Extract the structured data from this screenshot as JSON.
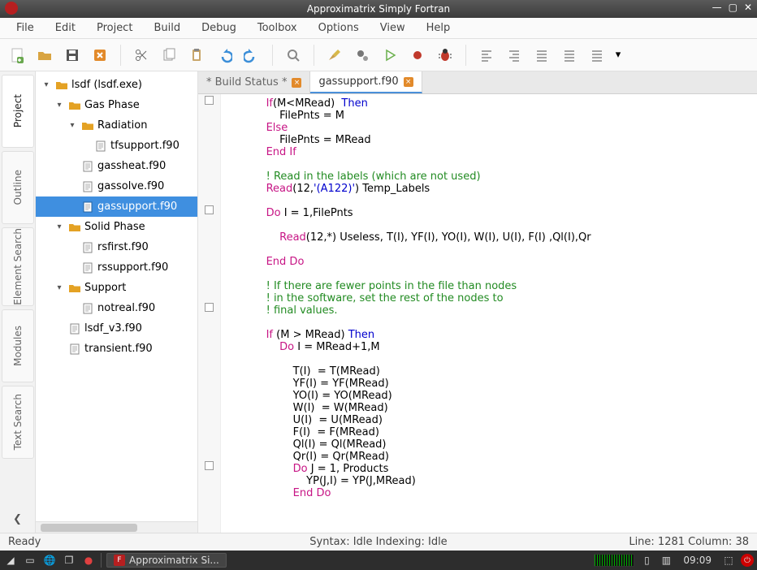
{
  "title": "Approximatrix Simply Fortran",
  "menus": [
    "File",
    "Edit",
    "Project",
    "Build",
    "Debug",
    "Toolbox",
    "Options",
    "View",
    "Help"
  ],
  "toolbar_buttons": [
    {
      "name": "new",
      "icon": "file-plus",
      "color": "#6aa84f"
    },
    {
      "name": "open",
      "icon": "folder-open",
      "color": "#d9a441"
    },
    {
      "name": "save",
      "icon": "floppy",
      "color": "#555"
    },
    {
      "name": "close",
      "icon": "close",
      "color": "#e28a2b"
    },
    {
      "name": "sep"
    },
    {
      "name": "cut",
      "icon": "scissors",
      "color": "#666"
    },
    {
      "name": "copy",
      "icon": "copy",
      "color": "#999"
    },
    {
      "name": "paste",
      "icon": "clipboard",
      "color": "#c9a76b"
    },
    {
      "name": "undo",
      "icon": "undo",
      "color": "#3b8ed8"
    },
    {
      "name": "redo",
      "icon": "redo",
      "color": "#3b8ed8"
    },
    {
      "name": "sep"
    },
    {
      "name": "find",
      "icon": "zoom",
      "color": "#888"
    },
    {
      "name": "sep"
    },
    {
      "name": "clean",
      "icon": "broom",
      "color": "#d8b94a"
    },
    {
      "name": "build",
      "icon": "gears",
      "color": "#777"
    },
    {
      "name": "run",
      "icon": "play",
      "color": "#6ab04c"
    },
    {
      "name": "record",
      "icon": "record",
      "color": "#c0392b"
    },
    {
      "name": "debug",
      "icon": "bug",
      "color": "#c0392b"
    },
    {
      "name": "sep"
    },
    {
      "name": "indent-left",
      "icon": "indentL",
      "color": "#888"
    },
    {
      "name": "indent-right",
      "icon": "indentR",
      "color": "#888"
    },
    {
      "name": "align1",
      "icon": "align",
      "color": "#888"
    },
    {
      "name": "align2",
      "icon": "align",
      "color": "#888"
    },
    {
      "name": "align3",
      "icon": "align",
      "color": "#888"
    }
  ],
  "sidepanels": [
    {
      "id": "project",
      "label": "Project",
      "active": true
    },
    {
      "id": "outline",
      "label": "Outline",
      "active": false
    },
    {
      "id": "elementsearch",
      "label": "Element Search",
      "active": false
    },
    {
      "id": "modules",
      "label": "Modules",
      "active": false
    },
    {
      "id": "textsearch",
      "label": "Text Search",
      "active": false
    }
  ],
  "tree": [
    {
      "d": 0,
      "name": "lsdf (lsdf.exe)",
      "type": "folder",
      "exp": true
    },
    {
      "d": 1,
      "name": "Gas Phase",
      "type": "folder",
      "exp": true
    },
    {
      "d": 2,
      "name": "Radiation",
      "type": "folder",
      "exp": true
    },
    {
      "d": 3,
      "name": "tfsupport.f90",
      "type": "file"
    },
    {
      "d": 2,
      "name": "gassheat.f90",
      "type": "file"
    },
    {
      "d": 2,
      "name": "gassolve.f90",
      "type": "file"
    },
    {
      "d": 2,
      "name": "gassupport.f90",
      "type": "file",
      "selected": true
    },
    {
      "d": 1,
      "name": "Solid Phase",
      "type": "folder",
      "exp": true
    },
    {
      "d": 2,
      "name": "rsfirst.f90",
      "type": "file"
    },
    {
      "d": 2,
      "name": "rssupport.f90",
      "type": "file"
    },
    {
      "d": 1,
      "name": "Support",
      "type": "folder",
      "exp": true
    },
    {
      "d": 2,
      "name": "notreal.f90",
      "type": "file"
    },
    {
      "d": 1,
      "name": "lsdf_v3.f90",
      "type": "file"
    },
    {
      "d": 1,
      "name": "transient.f90",
      "type": "file"
    }
  ],
  "tabs": [
    {
      "label": "* Build Status *",
      "active": false,
      "closable": true
    },
    {
      "label": "gassupport.f90",
      "active": true,
      "closable": true
    }
  ],
  "code": [
    {
      "t": "            ",
      "c": "black"
    },
    {
      "t": "If",
      "c": "pink"
    },
    {
      "t": "(M<MRead)  ",
      "c": "black"
    },
    {
      "t": "Then",
      "c": "blue"
    },
    {
      "t": "\n",
      "c": "black"
    },
    {
      "t": "                FilePnts = M\n",
      "c": "black"
    },
    {
      "t": "            ",
      "c": "black"
    },
    {
      "t": "Else",
      "c": "pink"
    },
    {
      "t": "\n",
      "c": "black"
    },
    {
      "t": "                FilePnts = MRead\n",
      "c": "black"
    },
    {
      "t": "            ",
      "c": "black"
    },
    {
      "t": "End If",
      "c": "pink"
    },
    {
      "t": "\n\n",
      "c": "black"
    },
    {
      "t": "            ",
      "c": "black"
    },
    {
      "t": "! Read in the labels (which are not used)",
      "c": "green"
    },
    {
      "t": "\n",
      "c": "black"
    },
    {
      "t": "            ",
      "c": "black"
    },
    {
      "t": "Read",
      "c": "pink"
    },
    {
      "t": "(12,",
      "c": "black"
    },
    {
      "t": "'(A122)'",
      "c": "blue"
    },
    {
      "t": ") Temp_Labels\n\n",
      "c": "black"
    },
    {
      "t": "            ",
      "c": "black"
    },
    {
      "t": "Do",
      "c": "pink"
    },
    {
      "t": " I = 1,FilePnts\n\n",
      "c": "black"
    },
    {
      "t": "                ",
      "c": "black"
    },
    {
      "t": "Read",
      "c": "pink"
    },
    {
      "t": "(12,*) Useless, T(I), YF(I), YO(I), W(I), U(I), F(I) ,Ql(I),Qr\n\n",
      "c": "black"
    },
    {
      "t": "            ",
      "c": "black"
    },
    {
      "t": "End Do",
      "c": "pink"
    },
    {
      "t": "\n\n",
      "c": "black"
    },
    {
      "t": "            ",
      "c": "black"
    },
    {
      "t": "! If there are fewer points in the file than nodes",
      "c": "green"
    },
    {
      "t": "\n",
      "c": "black"
    },
    {
      "t": "            ",
      "c": "black"
    },
    {
      "t": "! in the software, set the rest of the nodes to",
      "c": "green"
    },
    {
      "t": "\n",
      "c": "black"
    },
    {
      "t": "            ",
      "c": "black"
    },
    {
      "t": "! final values.",
      "c": "green"
    },
    {
      "t": "\n\n",
      "c": "black"
    },
    {
      "t": "            ",
      "c": "black"
    },
    {
      "t": "If",
      "c": "pink"
    },
    {
      "t": " (M > MRead) ",
      "c": "black"
    },
    {
      "t": "Then",
      "c": "blue"
    },
    {
      "t": "\n",
      "c": "black"
    },
    {
      "t": "                ",
      "c": "black"
    },
    {
      "t": "Do",
      "c": "pink"
    },
    {
      "t": " I = MRead+1,M\n\n",
      "c": "black"
    },
    {
      "t": "                    T(I)  = T(MRead)\n",
      "c": "black"
    },
    {
      "t": "                    YF(I) = YF(MRead)\n",
      "c": "black"
    },
    {
      "t": "                    YO(I) = YO(MRead)\n",
      "c": "black"
    },
    {
      "t": "                    W(I)  = W(MRead)\n",
      "c": "black"
    },
    {
      "t": "                    U(I)  = U(MRead)\n",
      "c": "black"
    },
    {
      "t": "                    F(I)  = F(MRead)\n",
      "c": "black"
    },
    {
      "t": "                    Ql(I) = Ql(MRead)\n",
      "c": "black"
    },
    {
      "t": "                    Qr(I) = Qr(MRead)\n",
      "c": "black"
    },
    {
      "t": "                    ",
      "c": "black"
    },
    {
      "t": "Do",
      "c": "pink"
    },
    {
      "t": " J = 1, Products\n",
      "c": "black"
    },
    {
      "t": "                        YP(J,I) = YP(J,MRead)\n",
      "c": "black"
    },
    {
      "t": "                    ",
      "c": "black"
    },
    {
      "t": "End Do",
      "c": "pink"
    },
    {
      "t": "\n",
      "c": "black"
    }
  ],
  "fold_rows": [
    0,
    9,
    17,
    30
  ],
  "status": {
    "left": "Ready",
    "center": "Syntax: Idle  Indexing: Idle",
    "right": "Line: 1281 Column: 38"
  },
  "taskbar": {
    "app_label": "Approximatrix Si...",
    "clock": "09:09"
  }
}
